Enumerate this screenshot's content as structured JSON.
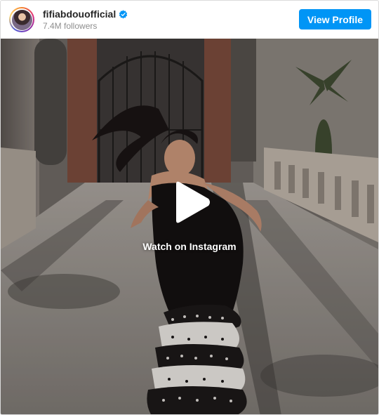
{
  "header": {
    "username": "fifiabdouofficial",
    "verified_icon": "verified-badge-icon",
    "followers": "7.4M followers",
    "view_profile_label": "View Profile"
  },
  "media": {
    "play_icon": "play-icon",
    "watch_label": "Watch on Instagram"
  },
  "colors": {
    "accent": "#0095f6",
    "username": "#262626",
    "secondary_text": "#8e8e8e",
    "border": "#dbdbdb"
  }
}
